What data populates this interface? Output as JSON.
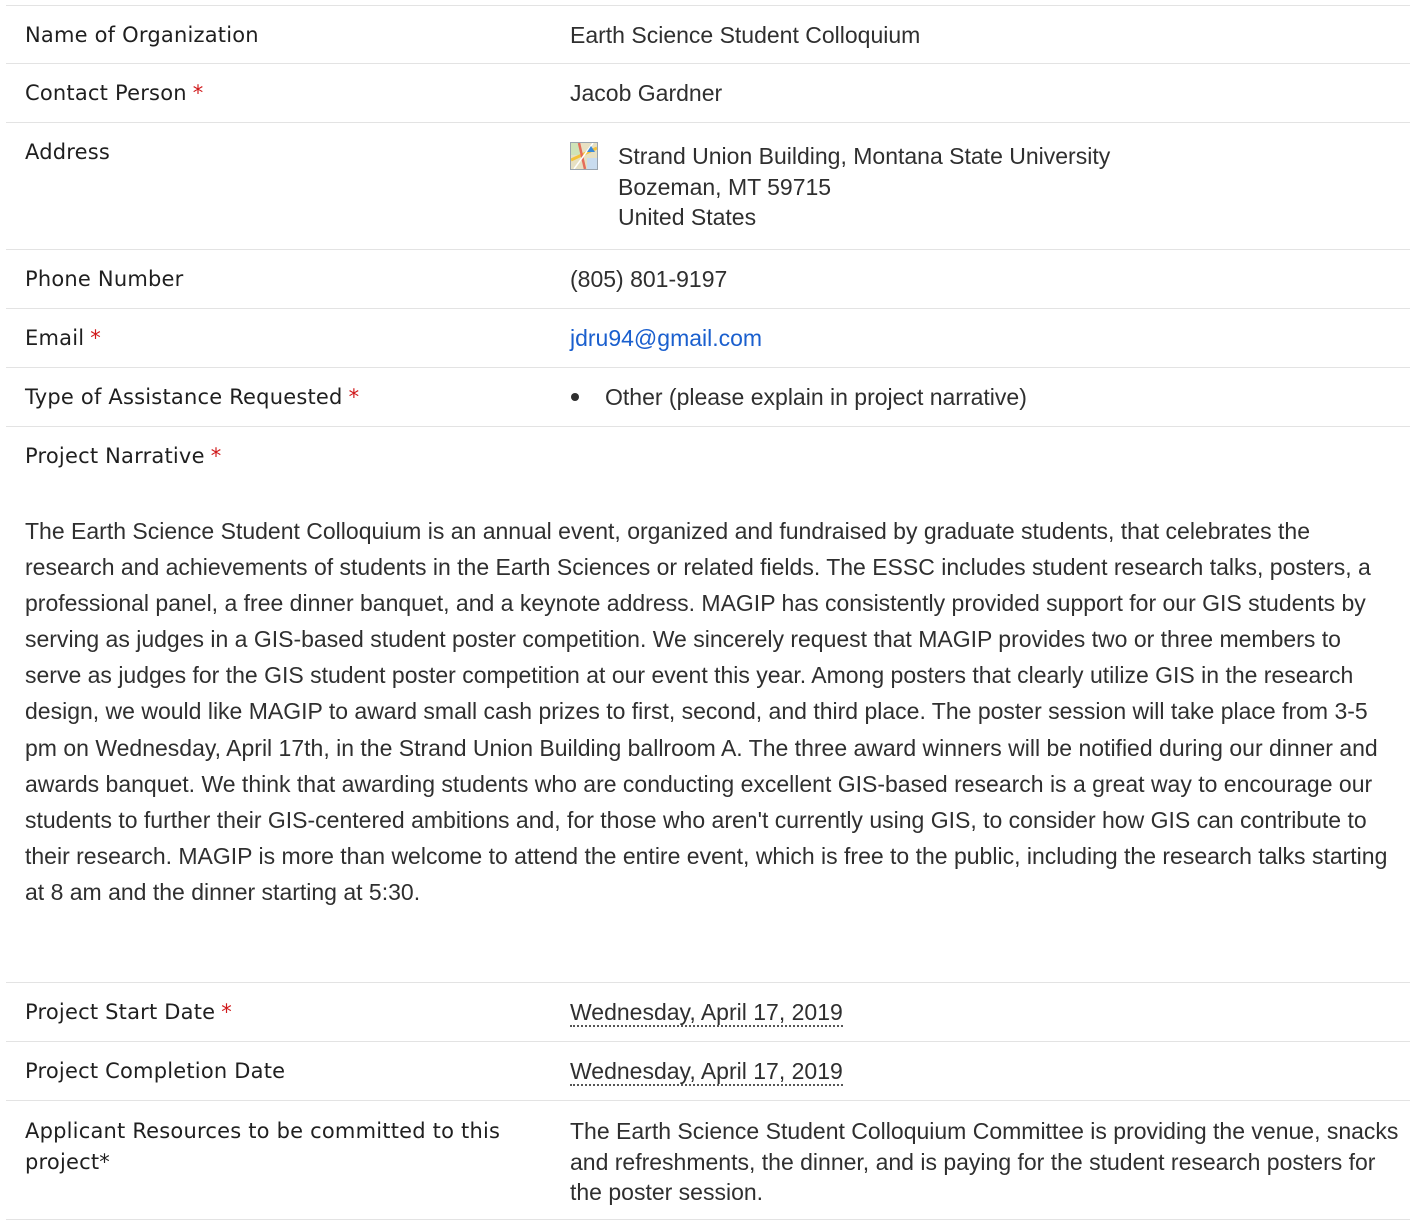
{
  "rows": {
    "organization": {
      "label": "Name of Organization",
      "value": "Earth Science Student Colloquium"
    },
    "contact": {
      "label": "Contact Person",
      "required_mark": "*",
      "value": "Jacob Gardner"
    },
    "address": {
      "label": "Address",
      "icon": "map-icon",
      "line1": "Strand Union Building, Montana State University",
      "line2": "Bozeman, MT 59715",
      "line3": "United States"
    },
    "phone": {
      "label": "Phone Number",
      "value": "(805) 801-9197"
    },
    "email": {
      "label": "Email",
      "required_mark": "*",
      "value": "jdru94@gmail.com"
    },
    "assistance": {
      "label": "Type of Assistance Requested",
      "required_mark": "*",
      "items": [
        "Other (please explain in project narrative)"
      ]
    },
    "narrative": {
      "label": "Project Narrative",
      "required_mark": "*",
      "text": "The Earth Science Student Colloquium is an annual event, organized and fundraised by graduate students, that celebrates the research and achievements of students in the Earth Sciences or related fields. The ESSC includes student research talks, posters, a professional panel, a free dinner banquet, and a keynote address. MAGIP has consistently provided support for our GIS students by serving as judges in a GIS-based student poster competition. We sincerely request that MAGIP provides two or three members to serve as judges for the GIS student poster competition at our event this year. Among posters that clearly utilize GIS in the research design, we would like MAGIP to award small cash prizes to first, second, and third place. The poster session will take place from 3-5 pm on Wednesday, April 17th, in the Strand Union Building ballroom A. The three award winners will be notified during our dinner and awards banquet. We think that awarding students who are conducting excellent GIS-based research is a great way to encourage our students to further their GIS-centered ambitions and, for those who aren't currently using GIS, to consider how GIS can contribute to their research. MAGIP is more than welcome to attend the entire event, which is free to the public, including the research talks starting at 8 am and the dinner starting at 5:30."
    },
    "start_date": {
      "label": "Project Start Date",
      "required_mark": "*",
      "value": "Wednesday, April 17, 2019"
    },
    "completion_date": {
      "label": "Project Completion Date",
      "value": "Wednesday, April 17, 2019"
    },
    "resources": {
      "label": "Applicant Resources to be committed to this project*",
      "value": "The Earth Science Student Colloquium Committee is providing the venue, snacks and refreshments, the dinner, and is paying for the student research posters for the poster session."
    }
  },
  "colors": {
    "required": "#d0191b",
    "link": "#1a5fce",
    "border": "#e3e3e3"
  }
}
